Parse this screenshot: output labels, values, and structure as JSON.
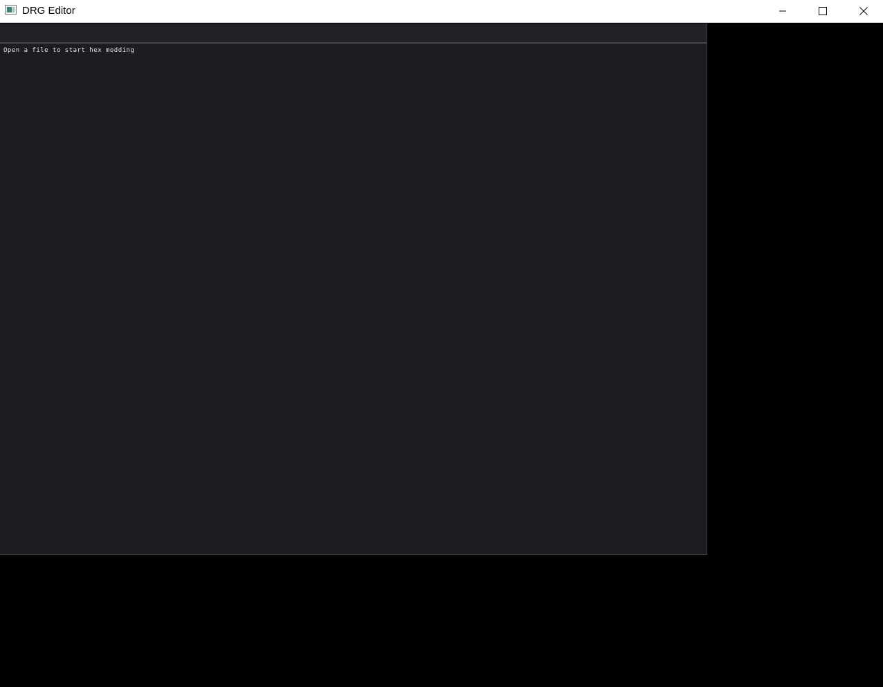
{
  "window": {
    "title": "DRG Editor",
    "icon": "app-icon"
  },
  "titlebar_buttons": {
    "minimize_icon": "minimize-icon",
    "maximize_icon": "maximize-icon",
    "close_icon": "close-icon"
  },
  "main": {
    "status_message": "Open a file to start hex modding"
  },
  "colors": {
    "panel_bg": "#1c1c21",
    "menubar_bg": "#222226",
    "outer_bg": "#000000",
    "titlebar_bg": "#ffffff"
  }
}
